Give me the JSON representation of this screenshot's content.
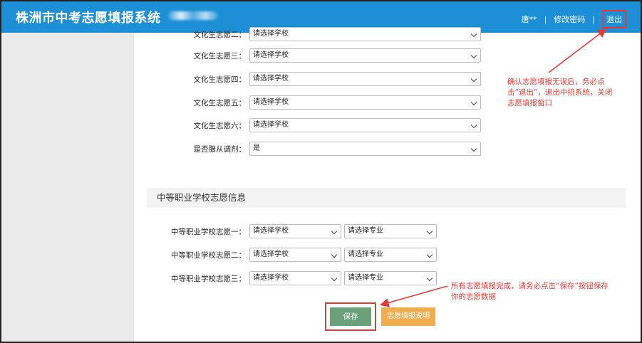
{
  "header": {
    "title": "株洲市中考志愿填报系统",
    "user": "唐**",
    "separator": "|",
    "change_password": "修改密码",
    "logout": "退出"
  },
  "culture": {
    "rows": [
      {
        "label": "文化生志愿二：",
        "value": "请选择学校"
      },
      {
        "label": "文化生志愿三：",
        "value": "请选择学校"
      },
      {
        "label": "文化生志愿四：",
        "value": "请选择学校"
      },
      {
        "label": "文化生志愿五：",
        "value": "请选择学校"
      },
      {
        "label": "文化生志愿六：",
        "value": "请选择学校"
      },
      {
        "label": "是否服从调剂：",
        "value": "是"
      }
    ]
  },
  "vocational": {
    "title": "中等职业学校志愿信息",
    "rows": [
      {
        "label": "中等职业学校志愿一：",
        "school": "请选择学校",
        "major": "请选择专业"
      },
      {
        "label": "中等职业学校志愿二：",
        "school": "请选择学校",
        "major": "请选择专业"
      },
      {
        "label": "中等职业学校志愿三：",
        "school": "请选择学校",
        "major": "请选择专业"
      }
    ]
  },
  "actions": {
    "save": "保存",
    "help": "志愿填报说明"
  },
  "annotations": {
    "logout_note": [
      "确认志愿填报无误后，务必点",
      "击“退出”，退出中招系统，关闭",
      "志愿填报窗口"
    ],
    "save_note": [
      "所有志愿填报完成，请务必点击“保存”按钮保存",
      "你的志愿数据"
    ]
  },
  "colors": {
    "header_bg": "#1c8fd6",
    "save_btn": "#6aa17a",
    "help_btn": "#f0ad4e",
    "annotation": "#e53935"
  }
}
